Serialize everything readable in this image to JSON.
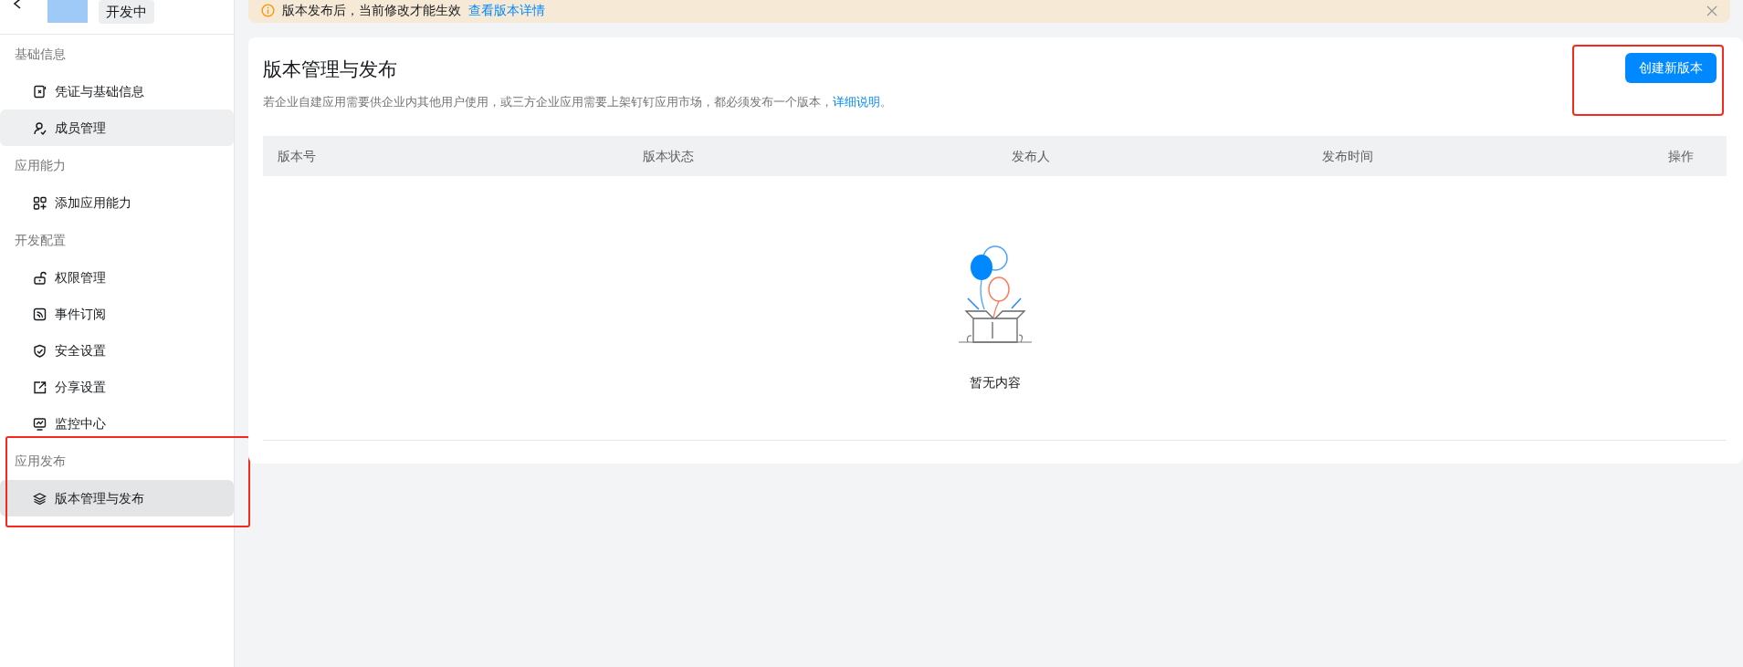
{
  "header": {
    "status_badge": "开发中"
  },
  "sidebar": {
    "groups": [
      {
        "label": "基础信息",
        "highlighted": false,
        "items": [
          {
            "label": "凭证与基础信息",
            "selected": false,
            "hovered": false
          },
          {
            "label": "成员管理",
            "selected": false,
            "hovered": true
          }
        ]
      },
      {
        "label": "应用能力",
        "highlighted": false,
        "items": [
          {
            "label": "添加应用能力",
            "selected": false,
            "hovered": false
          }
        ]
      },
      {
        "label": "开发配置",
        "highlighted": false,
        "items": [
          {
            "label": "权限管理",
            "selected": false,
            "hovered": false
          },
          {
            "label": "事件订阅",
            "selected": false,
            "hovered": false
          },
          {
            "label": "安全设置",
            "selected": false,
            "hovered": false
          },
          {
            "label": "分享设置",
            "selected": false,
            "hovered": false
          },
          {
            "label": "监控中心",
            "selected": false,
            "hovered": false
          }
        ]
      },
      {
        "label": "应用发布",
        "highlighted": true,
        "items": [
          {
            "label": "版本管理与发布",
            "selected": true,
            "hovered": false
          }
        ]
      }
    ]
  },
  "notice": {
    "text": "版本发布后，当前修改才能生效",
    "link": "查看版本详情"
  },
  "panel": {
    "title": "版本管理与发布",
    "description": "若企业自建应用需要供企业内其他用户使用，或三方企业应用需要上架钉钉应用市场，都必须发布一个版本，",
    "description_link": "详细说明",
    "description_end": "。",
    "create_button": {
      "label": "创建新版本",
      "highlighted": true
    }
  },
  "table": {
    "columns": [
      "版本号",
      "版本状态",
      "发布人",
      "发布时间",
      "操作"
    ],
    "empty_text": "暂无内容"
  }
}
